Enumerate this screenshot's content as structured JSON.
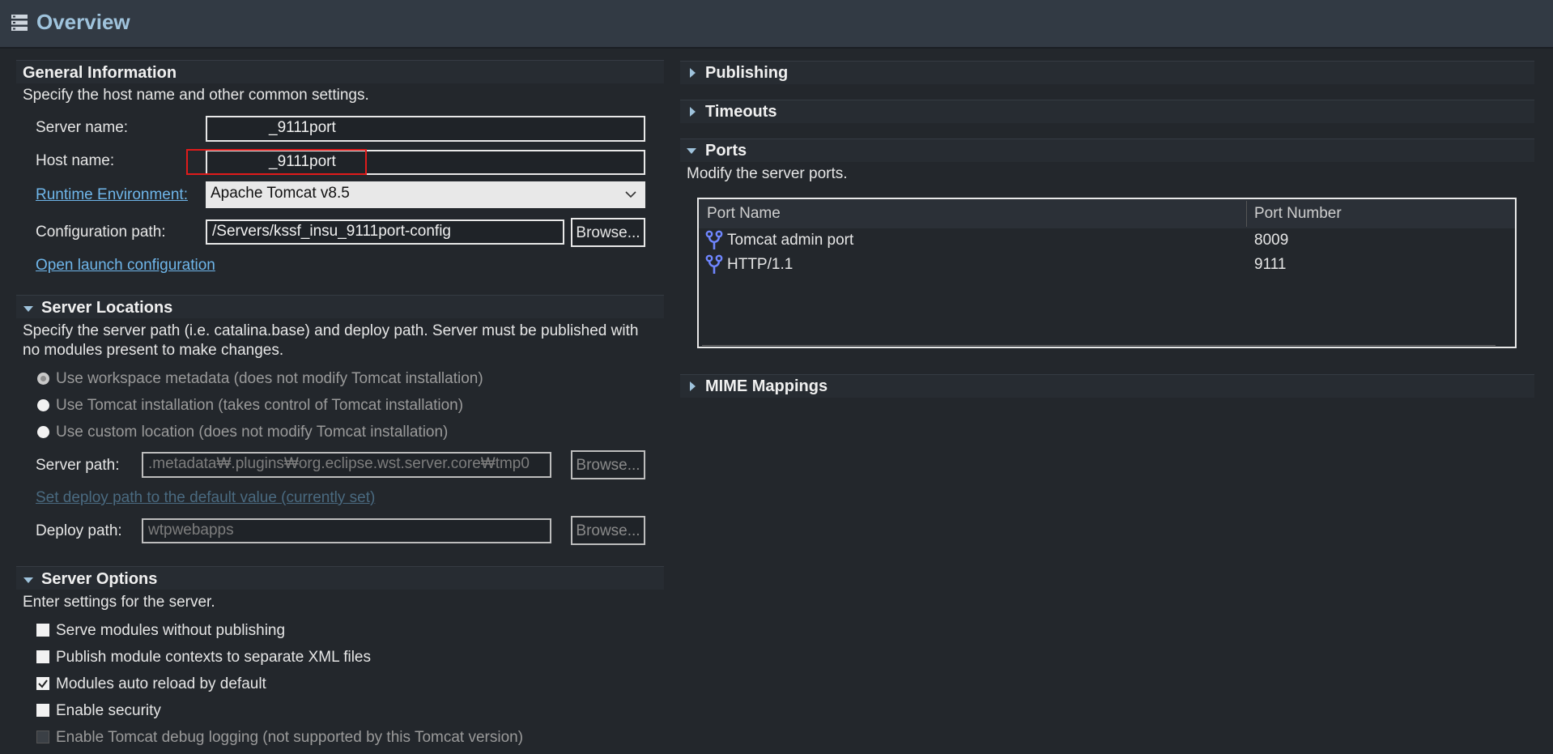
{
  "title": "Overview",
  "general": {
    "heading": "General Information",
    "description": "Specify the host name and other common settings.",
    "server_name_label": "Server name:",
    "server_name_value": "_9111port",
    "host_name_label": "Host name:",
    "host_name_value": "_9111port",
    "runtime_label": "Runtime Environment:",
    "runtime_value": "Apache Tomcat v8.5",
    "config_label": "Configuration path:",
    "config_value": "/Servers/kssf_insu_9111port-config",
    "browse_label": "Browse...",
    "open_launch": "Open launch configuration"
  },
  "locations": {
    "heading": "Server Locations",
    "description_1": "Specify the server path (i.e. catalina.base) and deploy path. Server must be published with",
    "description_2": "no modules present to make changes.",
    "options": [
      "Use workspace metadata (does not modify Tomcat installation)",
      "Use Tomcat installation (takes control of Tomcat installation)",
      "Use custom location (does not modify Tomcat installation)"
    ],
    "server_path_label": "Server path:",
    "server_path_value": ".metadata₩.plugins₩org.eclipse.wst.server.core₩tmp0",
    "browse_label": "Browse...",
    "set_deploy_link": "Set deploy path to the default value (currently set)",
    "deploy_path_label": "Deploy path:",
    "deploy_path_value": "wtpwebapps"
  },
  "options": {
    "heading": "Server Options",
    "description": "Enter settings for the server.",
    "items": [
      {
        "label": "Serve modules without publishing",
        "checked": false
      },
      {
        "label": "Publish module contexts to separate XML files",
        "checked": false
      },
      {
        "label": "Modules auto reload by default",
        "checked": true
      },
      {
        "label": "Enable security",
        "checked": false
      },
      {
        "label": "Enable Tomcat debug logging (not supported by this Tomcat version)",
        "checked": false
      }
    ]
  },
  "right": {
    "publishing": "Publishing",
    "timeouts": "Timeouts",
    "ports": "Ports",
    "ports_description": "Modify the server ports.",
    "col_name": "Port Name",
    "col_number": "Port Number",
    "rows": [
      {
        "name": "Tomcat admin port",
        "number": "8009"
      },
      {
        "name": "HTTP/1.1",
        "number": "9111"
      }
    ],
    "mime": "MIME Mappings"
  },
  "colors": {
    "accent": "#9fc3dc",
    "link": "#6fb6ea",
    "highlight": "#e01b1b"
  }
}
